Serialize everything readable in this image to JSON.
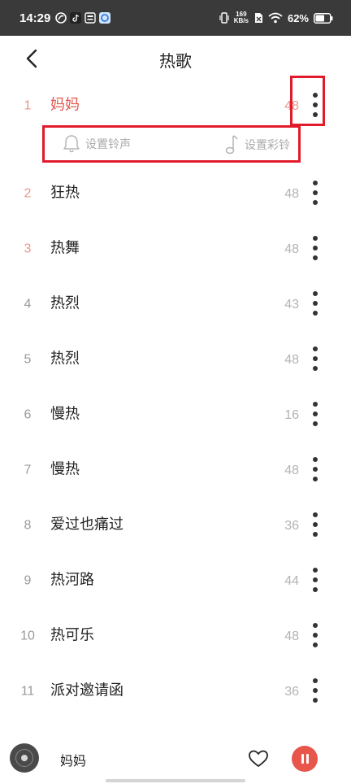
{
  "status_bar": {
    "time": "14:29",
    "net_speed_value": "169",
    "net_speed_unit": "KB/s",
    "battery": "62%"
  },
  "header": {
    "title": "热歌"
  },
  "actions": {
    "ringtone_label": "设置铃声",
    "color_ring_label": "设置彩铃"
  },
  "songs": [
    {
      "num": "1",
      "title": "妈妈",
      "count": "48"
    },
    {
      "num": "2",
      "title": "狂热",
      "count": "48"
    },
    {
      "num": "3",
      "title": "热舞",
      "count": "48"
    },
    {
      "num": "4",
      "title": "热烈",
      "count": "43"
    },
    {
      "num": "5",
      "title": "热烈",
      "count": "48"
    },
    {
      "num": "6",
      "title": "慢热",
      "count": "16"
    },
    {
      "num": "7",
      "title": "慢热",
      "count": "48"
    },
    {
      "num": "8",
      "title": "爱过也痛过",
      "count": "36"
    },
    {
      "num": "9",
      "title": "热河路",
      "count": "44"
    },
    {
      "num": "10",
      "title": "热可乐",
      "count": "48"
    },
    {
      "num": "11",
      "title": "派对邀请函",
      "count": "36"
    }
  ],
  "player": {
    "title": "妈妈"
  },
  "colors": {
    "accent": "#e2574c",
    "highlight_box": "#e21b2a",
    "status_bar_bg": "#3a3a3a"
  }
}
